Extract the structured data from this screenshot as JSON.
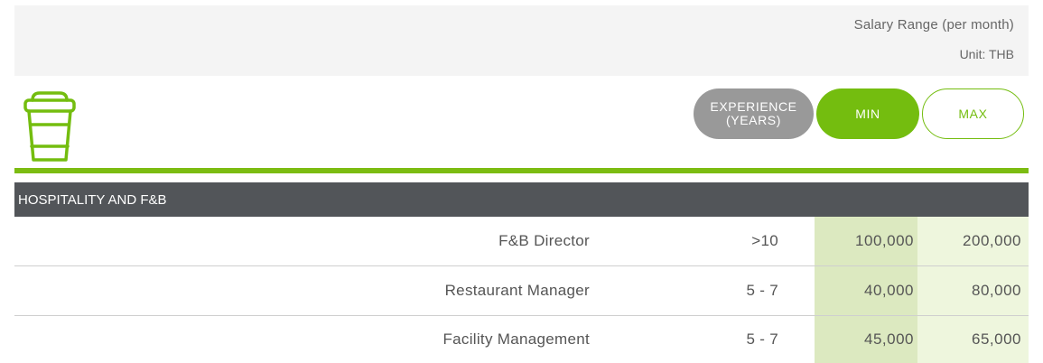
{
  "header": {
    "salary_range": "Salary Range  (per month)",
    "unit": "Unit: THB"
  },
  "icon": "coffee-cup-icon",
  "pills": {
    "experience": "EXPERIENCE\n(YEARS)",
    "min": "MIN",
    "max": "MAX"
  },
  "colors": {
    "accent": "#74bd0f",
    "header_bg": "#525559",
    "min_col": "#dce9c0",
    "max_col": "#eef6dd"
  },
  "section": {
    "title": "HOSPITALITY AND F&B"
  },
  "rows": [
    {
      "title": "F&B Director",
      "experience": ">10",
      "min": "100,000",
      "max": "200,000"
    },
    {
      "title": "Restaurant Manager",
      "experience": "5 - 7",
      "min": "40,000",
      "max": "80,000"
    },
    {
      "title": "Facility Management",
      "experience": "5 - 7",
      "min": "45,000",
      "max": "65,000"
    }
  ]
}
